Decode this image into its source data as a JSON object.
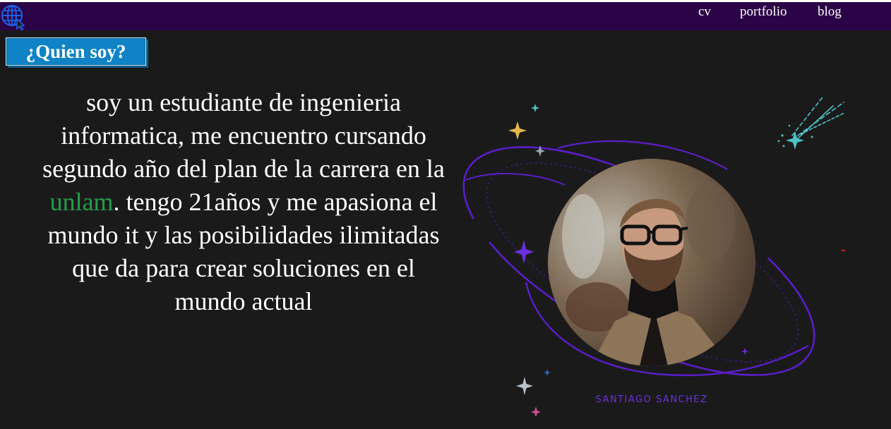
{
  "nav": {
    "logo_icon": "globe-cursor-icon",
    "links": [
      {
        "label": "cv"
      },
      {
        "label": "portfolio"
      },
      {
        "label": "blog"
      }
    ]
  },
  "hero": {
    "heading": "¿Quien soy?",
    "bio_part1": "soy un estudiante de ingenieria informatica, me encuentro cursando segundo año del plan de la carrera en la ",
    "bio_highlight": "unlam",
    "bio_part2": ". tengo 21años y me apasiona el mundo it y las posibilidades ilimitadas que da para crear soluciones en el mundo actual",
    "profile_name": "SANTIAGO SANCHEZ"
  },
  "colors": {
    "background": "#1b1a1b",
    "navbar": "#2a0446",
    "heading_bg": "#0f83c5",
    "highlight": "#21a04b",
    "accent_purple": "#6a30e0"
  }
}
